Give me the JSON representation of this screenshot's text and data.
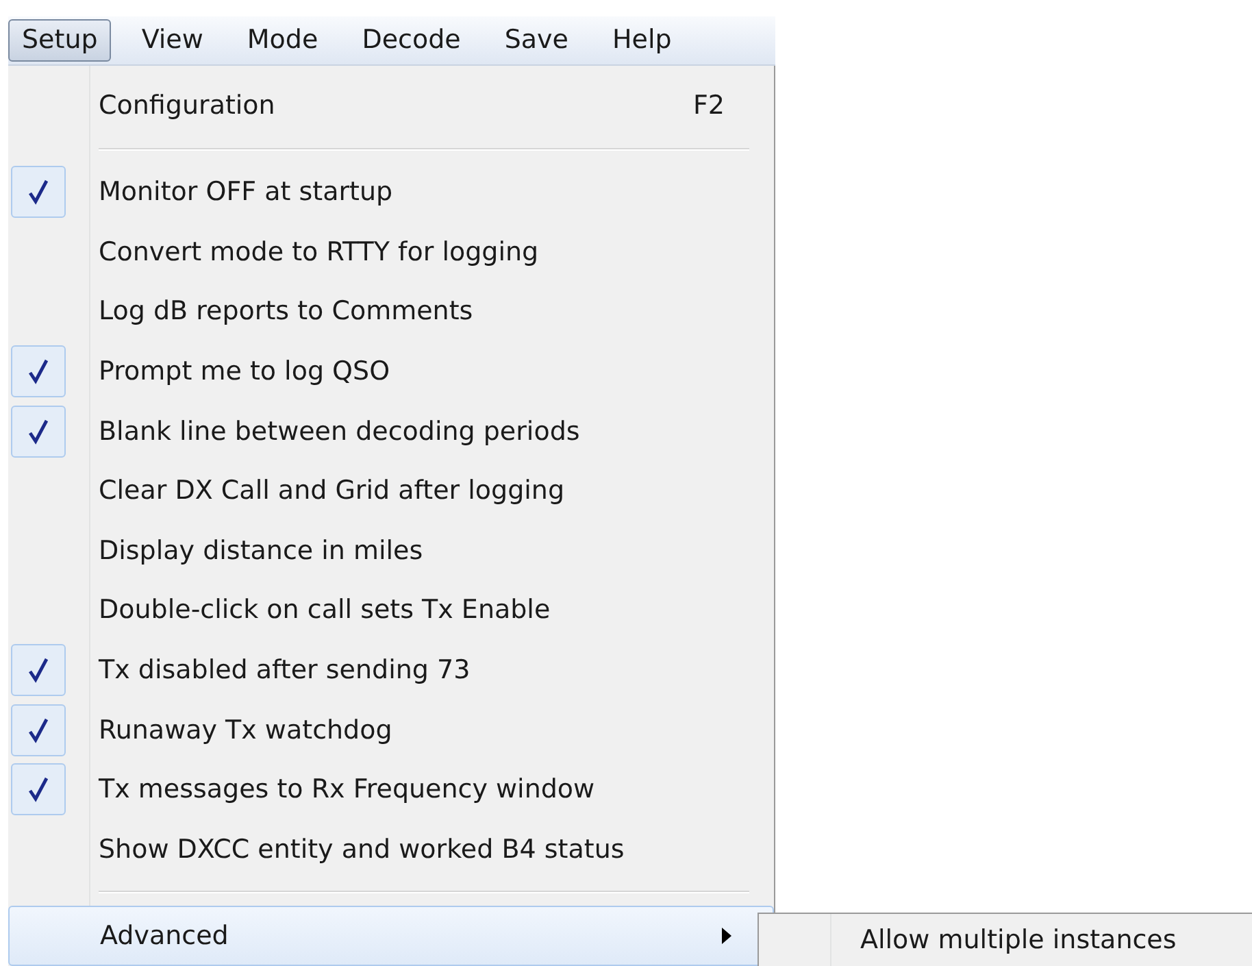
{
  "menubar": [
    {
      "label": "Setup",
      "selected": true
    },
    {
      "label": "View",
      "selected": false
    },
    {
      "label": "Mode",
      "selected": false
    },
    {
      "label": "Decode",
      "selected": false
    },
    {
      "label": "Save",
      "selected": false
    },
    {
      "label": "Help",
      "selected": false
    }
  ],
  "menu": [
    {
      "kind": "item",
      "label": "Configuration",
      "shortcut": "F2",
      "checked": false
    },
    {
      "kind": "separator"
    },
    {
      "kind": "item",
      "label": "Monitor OFF at startup",
      "checked": true
    },
    {
      "kind": "item",
      "label": "Convert mode to RTTY for logging",
      "checked": false
    },
    {
      "kind": "item",
      "label": "Log dB reports to Comments",
      "checked": false
    },
    {
      "kind": "item",
      "label": "Prompt me to log QSO",
      "checked": true
    },
    {
      "kind": "item",
      "label": "Blank line between decoding periods",
      "checked": true
    },
    {
      "kind": "item",
      "label": "Clear DX Call and Grid after logging",
      "checked": false
    },
    {
      "kind": "item",
      "label": "Display distance in miles",
      "checked": false
    },
    {
      "kind": "item",
      "label": "Double-click on call sets Tx Enable",
      "checked": false
    },
    {
      "kind": "item",
      "label": "Tx disabled after sending 73",
      "checked": true
    },
    {
      "kind": "item",
      "label": "Runaway Tx watchdog",
      "checked": true
    },
    {
      "kind": "item",
      "label": "Tx messages to Rx Frequency window",
      "checked": true
    },
    {
      "kind": "item",
      "label": "Show DXCC entity and worked B4 status",
      "checked": false
    },
    {
      "kind": "separator"
    },
    {
      "kind": "submenu",
      "label": "Advanced",
      "checked": false,
      "highlighted": true,
      "children": [
        {
          "label": "Allow multiple instances"
        }
      ]
    }
  ]
}
